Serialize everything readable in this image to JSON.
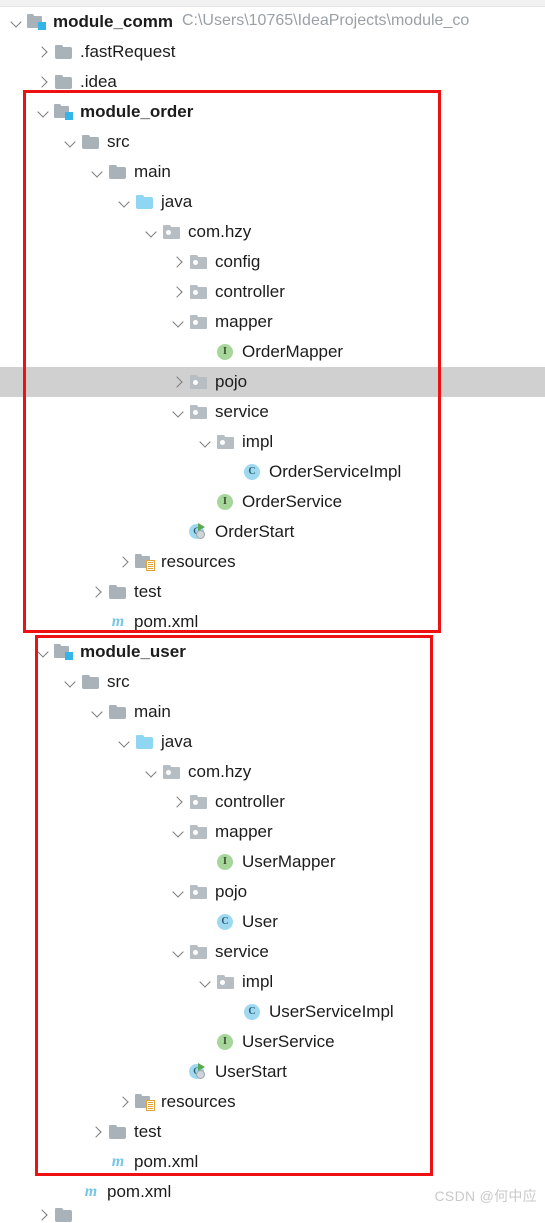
{
  "window": {
    "title": "module_comm",
    "project_path": "C:\\Users\\10765\\IdeaProjects\\module_co"
  },
  "watermark": "CSDN @何中应",
  "colors": {
    "annotation_box": "#ee1111",
    "selection": "#d0d0d0",
    "folder_gray": "#a9b2b9",
    "folder_blue": "#8ed6f2",
    "module_badge": "#35b4e8",
    "class_icon": "#9fd9f0",
    "interface_icon": "#a6d69a",
    "maven_icon": "#76c6e8",
    "path_text": "#9aa0a6"
  },
  "tree": [
    {
      "label": "module_comm",
      "icon": "module-folder-icon",
      "indent": 0,
      "arrow": "down",
      "bold": true,
      "path": "C:\\Users\\10765\\IdeaProjects\\module_co"
    },
    {
      "label": ".fastRequest",
      "icon": "folder-icon",
      "indent": 1,
      "arrow": "right",
      "bold": false
    },
    {
      "label": ".idea",
      "icon": "folder-icon",
      "indent": 1,
      "arrow": "right",
      "bold": false
    },
    {
      "label": "module_order",
      "icon": "module-folder-icon",
      "indent": 1,
      "arrow": "down",
      "bold": true
    },
    {
      "label": "src",
      "icon": "folder-icon",
      "indent": 2,
      "arrow": "down",
      "bold": false
    },
    {
      "label": "main",
      "icon": "folder-icon",
      "indent": 3,
      "arrow": "down",
      "bold": false
    },
    {
      "label": "java",
      "icon": "source-folder-icon",
      "indent": 4,
      "arrow": "down",
      "bold": false
    },
    {
      "label": "com.hzy",
      "icon": "package-icon",
      "indent": 5,
      "arrow": "down",
      "bold": false
    },
    {
      "label": "config",
      "icon": "package-icon",
      "indent": 6,
      "arrow": "right",
      "bold": false
    },
    {
      "label": "controller",
      "icon": "package-icon",
      "indent": 6,
      "arrow": "right",
      "bold": false
    },
    {
      "label": "mapper",
      "icon": "package-icon",
      "indent": 6,
      "arrow": "down",
      "bold": false
    },
    {
      "label": "OrderMapper",
      "icon": "interface-icon",
      "indent": 7,
      "arrow": "none",
      "bold": false
    },
    {
      "label": "pojo",
      "icon": "package-icon",
      "indent": 6,
      "arrow": "right",
      "bold": false,
      "selected": true
    },
    {
      "label": "service",
      "icon": "package-icon",
      "indent": 6,
      "arrow": "down",
      "bold": false
    },
    {
      "label": "impl",
      "icon": "package-icon",
      "indent": 7,
      "arrow": "down",
      "bold": false
    },
    {
      "label": "OrderServiceImpl",
      "icon": "class-icon",
      "indent": 8,
      "arrow": "none",
      "bold": false
    },
    {
      "label": "OrderService",
      "icon": "interface-icon",
      "indent": 7,
      "arrow": "none",
      "bold": false
    },
    {
      "label": "OrderStart",
      "icon": "runnable-class-icon",
      "indent": 6,
      "arrow": "none",
      "bold": false
    },
    {
      "label": "resources",
      "icon": "resources-folder-icon",
      "indent": 4,
      "arrow": "right",
      "bold": false
    },
    {
      "label": "test",
      "icon": "folder-icon",
      "indent": 3,
      "arrow": "right",
      "bold": false
    },
    {
      "label": "pom.xml",
      "icon": "maven-icon",
      "indent": 3,
      "arrow": "none",
      "bold": false
    },
    {
      "label": "module_user",
      "icon": "module-folder-icon",
      "indent": 1,
      "arrow": "down",
      "bold": true
    },
    {
      "label": "src",
      "icon": "folder-icon",
      "indent": 2,
      "arrow": "down",
      "bold": false
    },
    {
      "label": "main",
      "icon": "folder-icon",
      "indent": 3,
      "arrow": "down",
      "bold": false
    },
    {
      "label": "java",
      "icon": "source-folder-icon",
      "indent": 4,
      "arrow": "down",
      "bold": false
    },
    {
      "label": "com.hzy",
      "icon": "package-icon",
      "indent": 5,
      "arrow": "down",
      "bold": false
    },
    {
      "label": "controller",
      "icon": "package-icon",
      "indent": 6,
      "arrow": "right",
      "bold": false
    },
    {
      "label": "mapper",
      "icon": "package-icon",
      "indent": 6,
      "arrow": "down",
      "bold": false
    },
    {
      "label": "UserMapper",
      "icon": "interface-icon",
      "indent": 7,
      "arrow": "none",
      "bold": false
    },
    {
      "label": "pojo",
      "icon": "package-icon",
      "indent": 6,
      "arrow": "down",
      "bold": false
    },
    {
      "label": "User",
      "icon": "class-icon",
      "indent": 7,
      "arrow": "none",
      "bold": false
    },
    {
      "label": "service",
      "icon": "package-icon",
      "indent": 6,
      "arrow": "down",
      "bold": false
    },
    {
      "label": "impl",
      "icon": "package-icon",
      "indent": 7,
      "arrow": "down",
      "bold": false
    },
    {
      "label": "UserServiceImpl",
      "icon": "class-icon",
      "indent": 8,
      "arrow": "none",
      "bold": false
    },
    {
      "label": "UserService",
      "icon": "interface-icon",
      "indent": 7,
      "arrow": "none",
      "bold": false
    },
    {
      "label": "UserStart",
      "icon": "runnable-class-icon",
      "indent": 6,
      "arrow": "none",
      "bold": false
    },
    {
      "label": "resources",
      "icon": "resources-folder-icon",
      "indent": 4,
      "arrow": "right",
      "bold": false
    },
    {
      "label": "test",
      "icon": "folder-icon",
      "indent": 3,
      "arrow": "right",
      "bold": false
    },
    {
      "label": "pom.xml",
      "icon": "maven-icon",
      "indent": 3,
      "arrow": "none",
      "bold": false
    },
    {
      "label": "pom.xml",
      "icon": "maven-icon",
      "indent": 2,
      "arrow": "none",
      "bold": false
    },
    {
      "label": "",
      "icon": "folder-icon",
      "indent": 1,
      "arrow": "right",
      "bold": false,
      "partial": true
    }
  ],
  "annotations": [
    {
      "name": "module-order-highlight"
    },
    {
      "name": "module-user-highlight"
    }
  ]
}
